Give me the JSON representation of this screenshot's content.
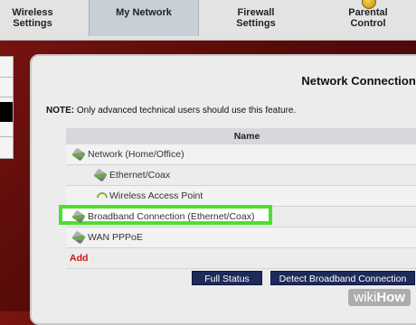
{
  "nav": {
    "items": [
      {
        "label_line1": "Wireless",
        "label_line2": "Settings"
      },
      {
        "label_line1": "My Network",
        "label_line2": ""
      },
      {
        "label_line1": "Firewall",
        "label_line2": "Settings"
      },
      {
        "label_line1": "Parental",
        "label_line2": "Control"
      }
    ]
  },
  "panel": {
    "title": "Network Connections",
    "note_bold": "NOTE:",
    "note_text": " Only advanced technical users should use this feature.",
    "table_header": "Name",
    "rows": [
      {
        "label": "Network (Home/Office)"
      },
      {
        "label": "Ethernet/Coax"
      },
      {
        "label": "Wireless Access Point"
      },
      {
        "label": "Broadband Connection (Ethernet/Coax)"
      },
      {
        "label": "WAN PPPoE"
      }
    ],
    "add_label": "Add",
    "buttons": {
      "full_status": "Full Status",
      "detect": "Detect Broadband Connection"
    }
  },
  "watermark": {
    "part1": "wiki",
    "part2": "How"
  }
}
